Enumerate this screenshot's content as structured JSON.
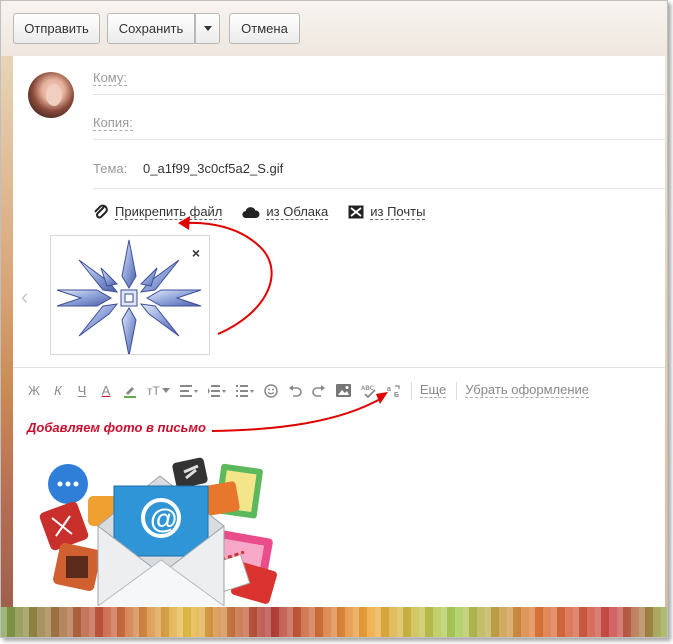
{
  "toolbar": {
    "send_label": "Отправить",
    "save_label": "Сохранить",
    "cancel_label": "Отмена"
  },
  "compose": {
    "to_label": "Кому:",
    "cc_label": "Копия:",
    "subject_label": "Тема:",
    "subject_value": "0_a1f99_3c0cf5a2_S.gif"
  },
  "attach": {
    "file_label": "Прикрепить файл",
    "cloud_label": "из Облака",
    "mail_label": "из Почты",
    "close_glyph": "×",
    "prev_glyph": "‹"
  },
  "format": {
    "bold": "Ж",
    "italic": "К",
    "underline": "Ч",
    "font_color": "А",
    "font_size": "тТ",
    "more_label": "Еще",
    "clear_label": "Убрать оформление"
  },
  "body": {
    "note": "Добавляем фото в письмо"
  },
  "colors": {
    "accent_red": "#c8102e",
    "annotation_red": "#e00000"
  },
  "icons": {
    "attach": "paperclip-icon",
    "cloud": "cloud-icon",
    "mail": "mail-x-icon",
    "image": "insert-image-icon",
    "spell": "spellcheck-icon",
    "emoji": "emoji-icon",
    "undo": "undo-icon",
    "redo": "redo-icon"
  }
}
